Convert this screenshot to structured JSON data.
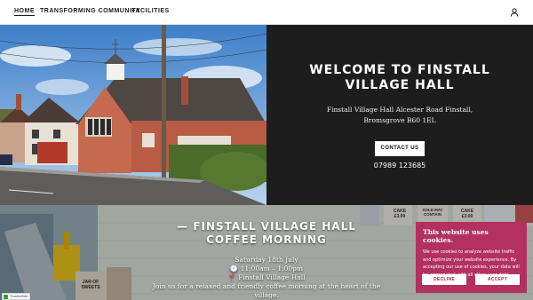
{
  "nav": {
    "items": [
      {
        "label": "HOME",
        "active": true
      },
      {
        "label": "TRANSFORMING COMMUNITY",
        "active": false
      },
      {
        "label": "FACILITIES",
        "active": false
      }
    ],
    "account_icon": "user-icon"
  },
  "hero": {
    "title": "WELCOME TO FINSTALL VILLAGE HALL",
    "address_name": "Finstall Village Hall",
    "address": "Alcester Road Finstall, Bromsgrove B60 1EL",
    "contact_label": "CONTACT US",
    "phone": "07989 123685"
  },
  "event": {
    "title": "— FINSTALL VILLAGE HALL COFFEE MORNING",
    "date": "Saturday 18th July",
    "time": "🕙 11:00am – 1:00pm",
    "location": "📍 Finstall Village Hall",
    "description": "Join us for a relaxed and friendly coffee morning at the heart of the village."
  },
  "cookie_banner": {
    "title": "This website uses cookies.",
    "text": "We use cookies to analyze website traffic and optimize your website experience. By accepting our use of cookies, your data will be aggregated with all other user data.",
    "decline_label": "DECLINE",
    "accept_label": "ACCEPT"
  },
  "signs": {
    "cake1": "CAKE £3.00",
    "sold_may": "SOLD MAY CONTAIN",
    "cake2": "CAKE £3.00",
    "jar": "JAR OF SWEETS"
  },
  "trust_badge": "TrustedSite",
  "colors": {
    "nav_bg": "#ffffff",
    "hero_panel": "#1d1d1d",
    "cookie_bg": "#b2315f",
    "accent_text": "#ffffff"
  }
}
